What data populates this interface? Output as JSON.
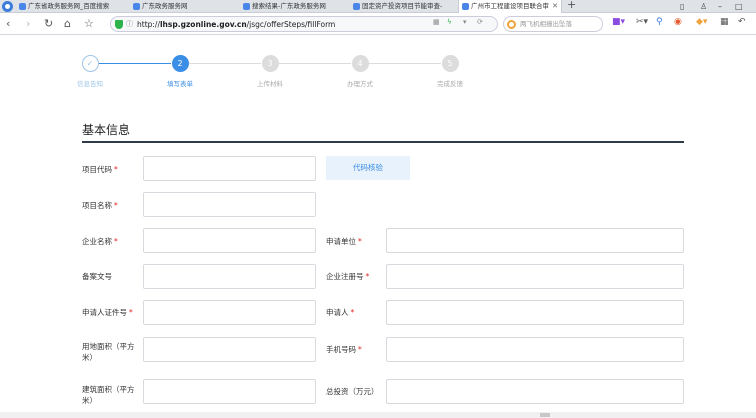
{
  "browser": {
    "tabs": [
      {
        "title": "广东省政务服务网_百度搜索",
        "active": false
      },
      {
        "title": "广东政务服务网",
        "active": false
      },
      {
        "title": "搜索结果-广东政务服务网",
        "active": false
      },
      {
        "title": "固定资产投资项目节能审查-",
        "active": false
      },
      {
        "title": "广州市工程建设项目联合审批",
        "active": true
      }
    ],
    "url_prefix": "http://",
    "url_host": "lhsp.gzonline.gov.cn",
    "url_path": "/jsgc/offerSteps/fillForm",
    "search_placeholder": "两飞机相撞出坠落"
  },
  "steps": [
    {
      "num": "✓",
      "label": "信息告知",
      "state": "done"
    },
    {
      "num": "2",
      "label": "填写表单",
      "state": "active"
    },
    {
      "num": "3",
      "label": "上传材料",
      "state": "pending"
    },
    {
      "num": "4",
      "label": "办理方式",
      "state": "pending"
    },
    {
      "num": "5",
      "label": "完成反馈",
      "state": "pending"
    }
  ],
  "section": {
    "title": "基本信息"
  },
  "form": {
    "project_code": {
      "label": "项目代码",
      "required": "*"
    },
    "verify_button": "代码核验",
    "project_name": {
      "label": "项目名称",
      "required": "*"
    },
    "company_name": {
      "label": "企业名称",
      "required": "*"
    },
    "applicant_unit": {
      "label": "申请单位",
      "required": "*"
    },
    "filing_no": {
      "label": "备案文号",
      "required": ""
    },
    "company_reg_no": {
      "label": "企业注册号",
      "required": "*"
    },
    "applicant_id": {
      "label": "申请人证件号",
      "required": "*"
    },
    "applicant": {
      "label": "申请人",
      "required": "*"
    },
    "land_area": {
      "label": "用地面积（平方米）",
      "required": ""
    },
    "mobile": {
      "label": "手机号码",
      "required": "*"
    },
    "building_area": {
      "label": "建筑面积（平方米）",
      "required": ""
    },
    "total_investment": {
      "label": "总投资（万元）",
      "required": ""
    }
  },
  "colors": {
    "accent": "#3a8ee6",
    "required": "#e02424"
  }
}
